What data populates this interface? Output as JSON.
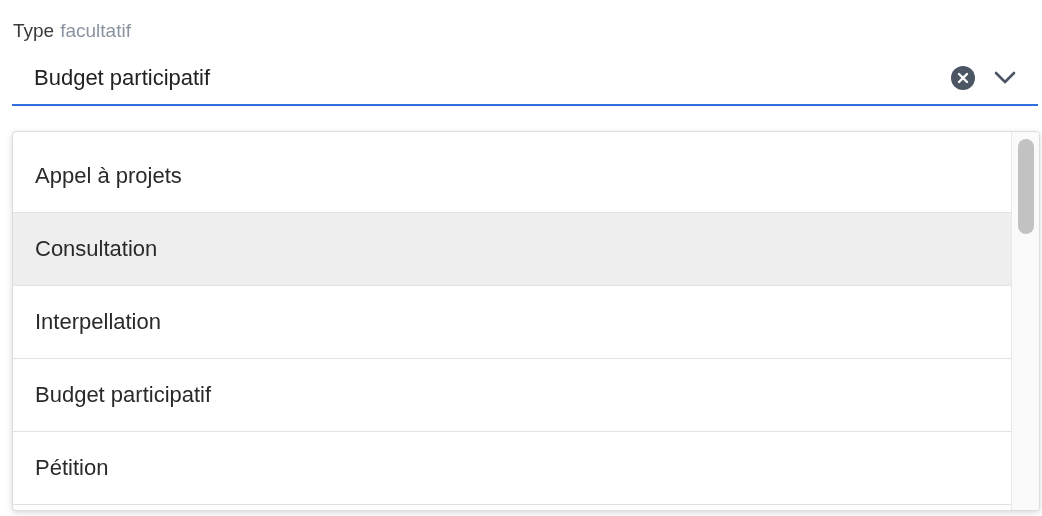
{
  "field": {
    "label": "Type",
    "hint": "facultatif",
    "value": "Budget participatif"
  },
  "options": [
    {
      "label": "Appel à projets",
      "highlighted": false
    },
    {
      "label": "Consultation",
      "highlighted": true
    },
    {
      "label": "Interpellation",
      "highlighted": false
    },
    {
      "label": "Budget participatif",
      "highlighted": false
    },
    {
      "label": "Pétition",
      "highlighted": false
    }
  ]
}
